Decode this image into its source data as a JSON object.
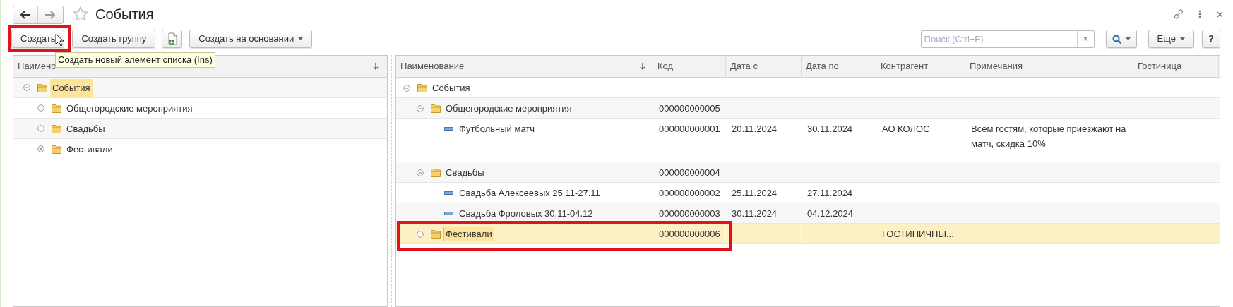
{
  "window": {
    "title": "События"
  },
  "toolbar": {
    "buttons": [
      {
        "kind": "text",
        "label": "Создать"
      },
      {
        "kind": "text",
        "label": "Создать группу"
      },
      {
        "kind": "icon"
      },
      {
        "kind": "menu",
        "label": "Создать на основании"
      }
    ],
    "tooltip": "Создать новый элемент списка (Ins)",
    "search": {
      "placeholder": "Поиск (Ctrl+F)",
      "clear": "×"
    },
    "more_button": "Еще",
    "help_button": "?"
  },
  "groups_tree": {
    "column": "Наимено",
    "items": [
      {
        "name": "События",
        "selected": true,
        "expandable": true,
        "expanded": true,
        "children": [
          {
            "name": "Общегородские мероприятия",
            "selected": false,
            "expandable": false
          },
          {
            "name": "Свадьбы",
            "selected": false,
            "expandable": false
          },
          {
            "name": "Фестивали",
            "selected": false,
            "expandable": true,
            "expanded": false
          }
        ]
      }
    ]
  },
  "list": {
    "columns": [
      "Наименование",
      "Код",
      "Дата с",
      "Дата по",
      "Контрагент",
      "Примечания",
      "Гостиница"
    ],
    "rows": [
      {
        "kind": "group",
        "expandable": true,
        "expanded": true,
        "selected": false,
        "cells": {
          "name": "События"
        },
        "children": [
          {
            "kind": "group",
            "expandable": true,
            "expanded": true,
            "selected": false,
            "cells": {
              "name": "Общегородские мероприятия",
              "code": "000000000005"
            },
            "children": [
              {
                "kind": "item",
                "selected": false,
                "cells": {
                  "name": "Футбольный матч",
                  "code": "000000000001",
                  "date_from": "20.11.2024",
                  "date_to": "30.11.2024",
                  "counterparty": "АО КОЛОС",
                  "notes": "Всем гостям, которые приезжают на матч, скидка 10%"
                }
              }
            ]
          },
          {
            "kind": "group",
            "expandable": true,
            "expanded": true,
            "selected": false,
            "cells": {
              "name": "Свадьбы",
              "code": "000000000004"
            },
            "children": [
              {
                "kind": "item",
                "selected": false,
                "cells": {
                  "name": "Свадьба Алексеевых 25.11-27.11",
                  "code": "000000000002",
                  "date_from": "25.11.2024",
                  "date_to": "27.11.2024"
                }
              },
              {
                "kind": "item",
                "selected": false,
                "cells": {
                  "name": "Свадьба Фроловых 30.11-04.12",
                  "code": "000000000003",
                  "date_from": "30.11.2024",
                  "date_to": "04.12.2024"
                }
              }
            ]
          },
          {
            "kind": "group",
            "expandable": false,
            "selected": true,
            "cells": {
              "name": "Фестивали",
              "code": "000000000006",
              "counterparty": "ГОСТИНИЧНЫ..."
            }
          }
        ]
      }
    ]
  }
}
